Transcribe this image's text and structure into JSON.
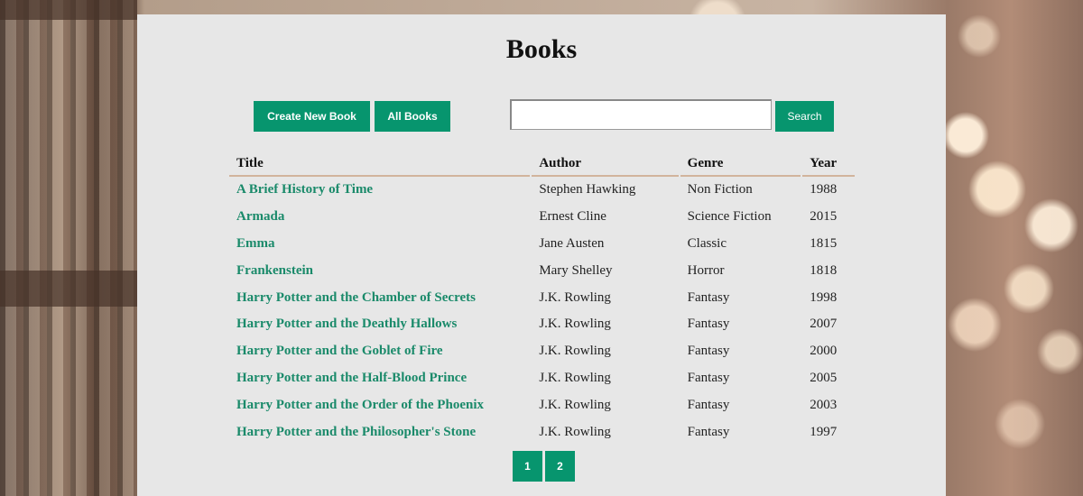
{
  "colors": {
    "accent": "#07956e",
    "link": "#1a8a6a",
    "panel": "#e7e7e7",
    "header_rule": "#d2b49c"
  },
  "page": {
    "title": "Books"
  },
  "toolbar": {
    "create_label": "Create New Book",
    "all_label": "All Books",
    "search_label": "Search",
    "search_value": ""
  },
  "table": {
    "headers": [
      "Title",
      "Author",
      "Genre",
      "Year"
    ],
    "rows": [
      {
        "title": "A Brief History of Time",
        "author": "Stephen Hawking",
        "genre": "Non Fiction",
        "year": "1988"
      },
      {
        "title": "Armada",
        "author": "Ernest Cline",
        "genre": "Science Fiction",
        "year": "2015"
      },
      {
        "title": "Emma",
        "author": "Jane Austen",
        "genre": "Classic",
        "year": "1815"
      },
      {
        "title": "Frankenstein",
        "author": "Mary Shelley",
        "genre": "Horror",
        "year": "1818"
      },
      {
        "title": "Harry Potter and the Chamber of Secrets",
        "author": "J.K. Rowling",
        "genre": "Fantasy",
        "year": "1998"
      },
      {
        "title": "Harry Potter and the Deathly Hallows",
        "author": "J.K. Rowling",
        "genre": "Fantasy",
        "year": "2007"
      },
      {
        "title": "Harry Potter and the Goblet of Fire",
        "author": "J.K. Rowling",
        "genre": "Fantasy",
        "year": "2000"
      },
      {
        "title": "Harry Potter and the Half-Blood Prince",
        "author": "J.K. Rowling",
        "genre": "Fantasy",
        "year": "2005"
      },
      {
        "title": "Harry Potter and the Order of the Phoenix",
        "author": "J.K. Rowling",
        "genre": "Fantasy",
        "year": "2003"
      },
      {
        "title": "Harry Potter and the Philosopher's Stone",
        "author": "J.K. Rowling",
        "genre": "Fantasy",
        "year": "1997"
      }
    ]
  },
  "pagination": {
    "pages": [
      "1",
      "2"
    ]
  }
}
